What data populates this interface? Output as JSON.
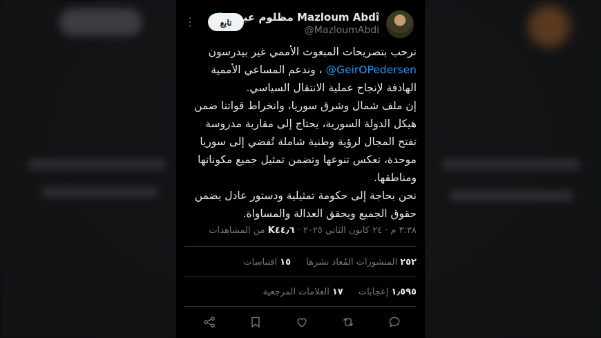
{
  "author": {
    "name": "Mazloum Abdî مظلوم عبدي",
    "handle": "@MazloumAbdi",
    "follow_label": "تابع"
  },
  "tweet": {
    "lines": [
      "نرحب بتصريحات المبعوث الأممي غير بيدرسون",
      "، وندعم المساعي الأممية",
      "الهادفة لإنجاح عملية الانتقال السياسي.",
      "إن ملف شمال وشرق سوريا، وانخراط قواتنا ضمن",
      "هيكل الدولة السورية، يحتاج إلى مقاربة مدروسة",
      "تفتح المجال لرؤية وطنية شاملة تُفضي إلى سوريا",
      "موحدة، تعكس تنوعها وتضمن تمثيل جميع مكوناتها",
      "ومناطقها.",
      "نحن بحاجة إلى حكومة تمثيلية ودستور عادل يضمن",
      "حقوق الجميع ويحقق العدالة والمساواة."
    ],
    "mention": "@GeirOPedersen"
  },
  "meta": {
    "timestamp": "٣:٣٨ م · ٢٤ كانون الثاني ٢٠٢٥ · ",
    "views_count": "K٤٤٫٦",
    "views_label": " من المشاهدات"
  },
  "stats_row1": {
    "reposts_count": "٢٥٢",
    "reposts_label": "المنشورات المُعاد نشرها",
    "quotes_count": "١٥",
    "quotes_label": "اقتباسات"
  },
  "stats_row2": {
    "likes_count": "١٫٥٩٥",
    "likes_label": "إعجابات",
    "bookmarks_count": "١٧",
    "bookmarks_label": "العلامات المرجعية"
  },
  "icons": {
    "verified": "verified-badge-icon",
    "more": "more-options-icon",
    "reply": "reply-icon",
    "repost": "repost-icon",
    "like": "heart-icon",
    "bookmark": "bookmark-icon",
    "share": "share-icon"
  },
  "colors": {
    "accent": "#1d9bf0",
    "background": "#000000",
    "text": "#e7e9ea",
    "muted": "#71767b"
  }
}
